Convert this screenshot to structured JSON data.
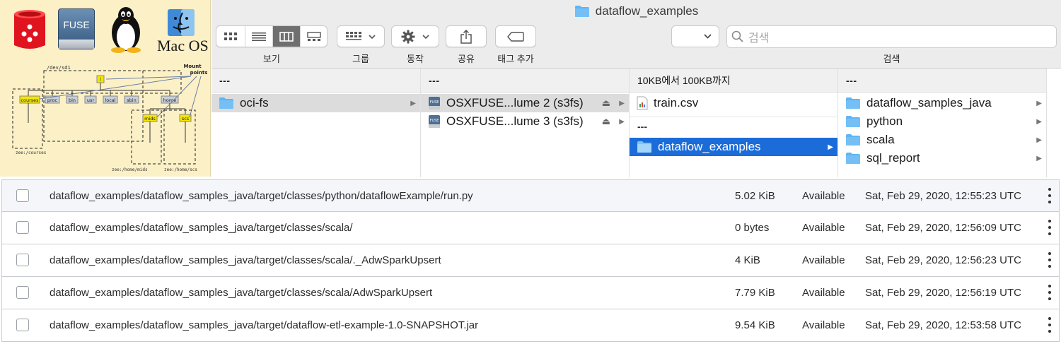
{
  "logos": {
    "fuse_text": "FUSE",
    "macos_text": "Mac OS"
  },
  "diagram": {
    "dev_label": "/dev/sd1",
    "mount_label": "Mount points",
    "root_label": "/",
    "nodes": [
      "courses",
      "proc",
      "bin",
      "usr",
      "local",
      "sbin",
      "home"
    ],
    "sub_nodes": [
      "mids",
      "scs"
    ],
    "captions": [
      "zee:/courses",
      "zee:/home/mids",
      "zee:/home/scs"
    ]
  },
  "window": {
    "title": "dataflow_examples"
  },
  "toolbar": {
    "view_label": "보기",
    "group_label": "그룹",
    "action_label": "동작",
    "share_label": "공유",
    "tags_label": "태그 추가",
    "search_placeholder": "검색",
    "search_label": "검색"
  },
  "columns": [
    {
      "header": "---",
      "items": [
        {
          "name": "oci-fs"
        }
      ]
    },
    {
      "header": "---",
      "items": [
        {
          "name": "OSXFUSE...lume 2 (s3fs)"
        },
        {
          "name": "OSXFUSE...lume 3 (s3fs)"
        }
      ]
    },
    {
      "header": "10KB에서 100KB까지",
      "items": [
        {
          "name": "train.csv"
        }
      ],
      "separator": "---",
      "items2": [
        {
          "name": "dataflow_examples"
        }
      ]
    },
    {
      "header": "---",
      "items": [
        {
          "name": "dataflow_samples_java"
        },
        {
          "name": "python"
        },
        {
          "name": "scala"
        },
        {
          "name": "sql_report"
        }
      ]
    }
  ],
  "objects": [
    {
      "name": "dataflow_examples/dataflow_samples_java/target/classes/python/dataflowExample/run.py",
      "size": "5.02 KiB",
      "status": "Available",
      "date": "Sat, Feb 29, 2020, 12:55:23 UTC"
    },
    {
      "name": "dataflow_examples/dataflow_samples_java/target/classes/scala/",
      "size": "0 bytes",
      "status": "Available",
      "date": "Sat, Feb 29, 2020, 12:56:09 UTC"
    },
    {
      "name": "dataflow_examples/dataflow_samples_java/target/classes/scala/._AdwSparkUpsert",
      "size": "4 KiB",
      "status": "Available",
      "date": "Sat, Feb 29, 2020, 12:56:23 UTC"
    },
    {
      "name": "dataflow_examples/dataflow_samples_java/target/classes/scala/AdwSparkUpsert",
      "size": "7.79 KiB",
      "status": "Available",
      "date": "Sat, Feb 29, 2020, 12:56:19 UTC"
    },
    {
      "name": "dataflow_examples/dataflow_samples_java/target/dataflow-etl-example-1.0-SNAPSHOT.jar",
      "size": "9.54 KiB",
      "status": "Available",
      "date": "Sat, Feb 29, 2020, 12:53:58 UTC"
    }
  ],
  "colors": {
    "selection_blue": "#1b6cd9",
    "folder_blue": "#5fb5f3",
    "panel_yellow": "#fcf0c6"
  }
}
